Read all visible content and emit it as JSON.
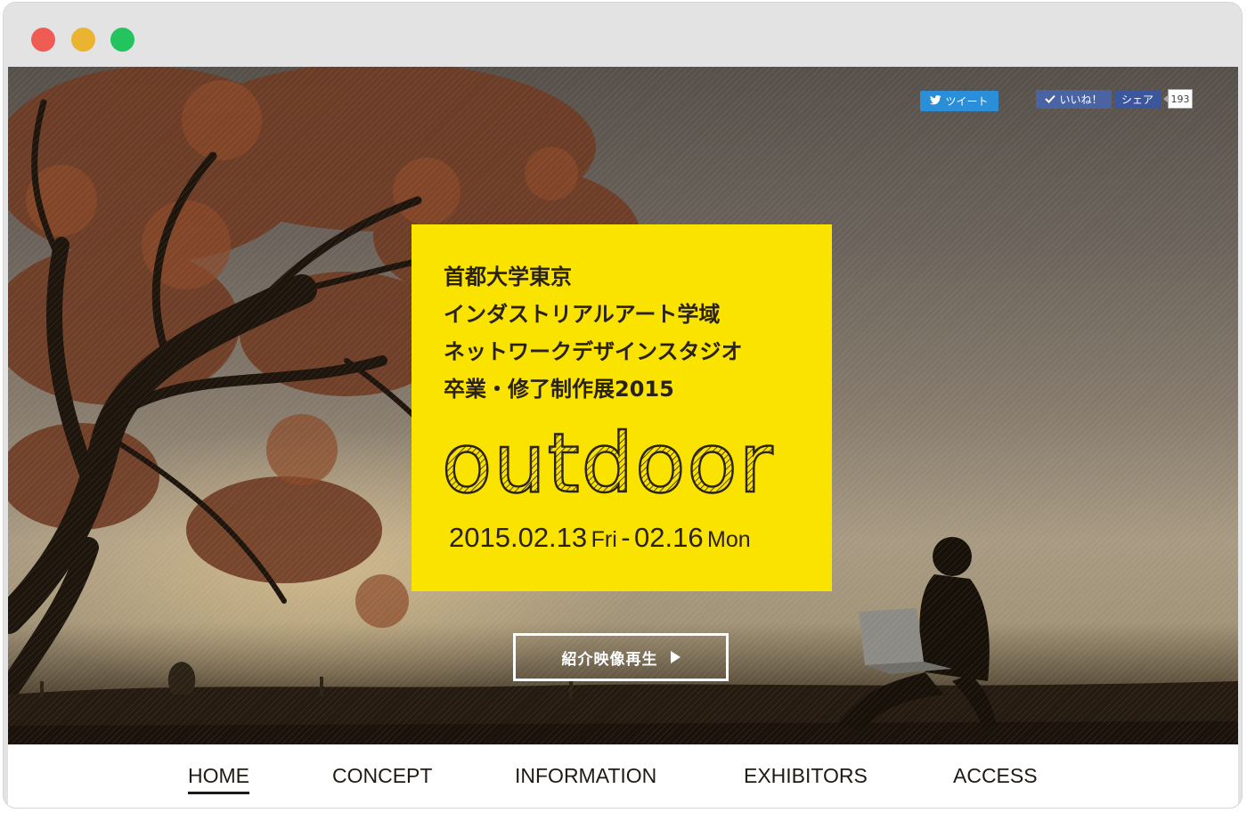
{
  "social": {
    "tweet_label": "ツイート",
    "like_label": "いいね！",
    "share_label": "シェア",
    "share_count": "193"
  },
  "hero": {
    "title_lines": [
      "首都大学東京",
      "インダストリアルアート学域",
      "ネットワークデザインスタジオ",
      "卒業・修了制作展2015"
    ],
    "logo_text": "outdoor",
    "date_start": "2015.02.13",
    "day_start": "Fri",
    "date_separator": "-",
    "date_end": "02.16",
    "day_end": "Mon",
    "video_button_label": "紹介映像再生",
    "card_color": "#fbe300"
  },
  "nav": {
    "items": [
      {
        "label": "HOME",
        "active": true
      },
      {
        "label": "CONCEPT",
        "active": false
      },
      {
        "label": "INFORMATION",
        "active": false
      },
      {
        "label": "EXHIBITORS",
        "active": false
      },
      {
        "label": "ACCESS",
        "active": false
      }
    ]
  },
  "icons": {
    "tweet": "twitter-bird-icon",
    "like": "checkmark-icon",
    "video": "play-icon"
  }
}
